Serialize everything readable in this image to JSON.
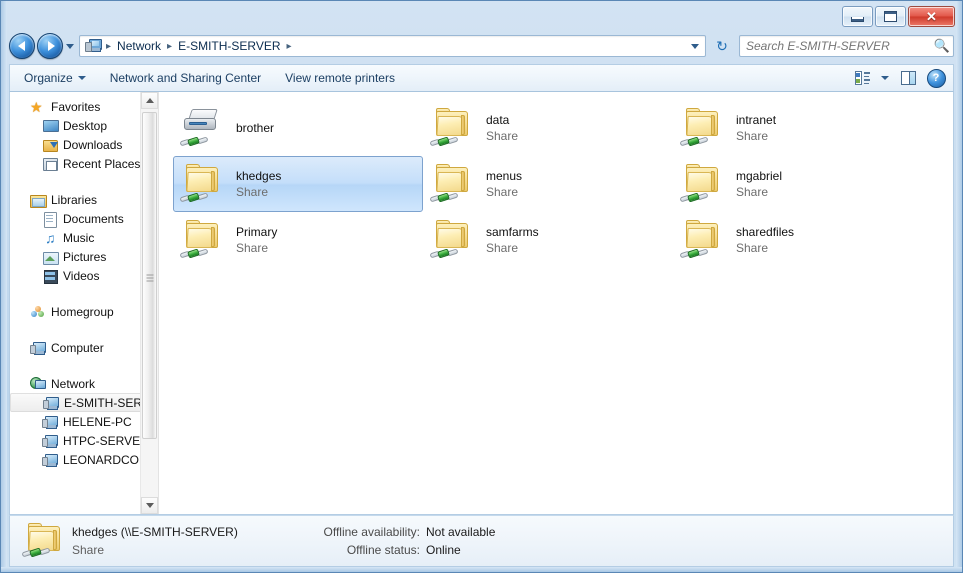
{
  "window": {
    "caption_buttons": [
      {
        "name": "minimize",
        "glyph": "minimize-icon"
      },
      {
        "name": "maximize",
        "glyph": "maximize-icon"
      },
      {
        "name": "close",
        "glyph": "close-icon",
        "label": "✕",
        "color": "#d64b38"
      }
    ]
  },
  "navigation": {
    "back_tooltip": "Back",
    "forward_tooltip": "Forward",
    "recent_pages_tooltip": "Recent pages",
    "refresh_label": "↻",
    "address": {
      "icon": "network-computer-icon",
      "crumbs": [
        "Network",
        "E-SMITH-SERVER"
      ],
      "separator": "▸"
    },
    "search": {
      "placeholder": "Search E-SMITH-SERVER",
      "value": "",
      "icon": "search-icon"
    }
  },
  "toolbar": {
    "organize_label": "Organize",
    "network_sharing_label": "Network and Sharing Center",
    "view_remote_printers_label": "View remote printers",
    "change_view_tooltip": "Change your view",
    "preview_pane_tooltip": "Show the preview pane",
    "help_label": "?",
    "help_tooltip": "Get help"
  },
  "sidebar": {
    "groups": [
      {
        "header": {
          "label": "Favorites",
          "icon": "star-icon"
        },
        "items": [
          {
            "label": "Desktop",
            "icon": "desktop-icon"
          },
          {
            "label": "Downloads",
            "icon": "downloads-icon"
          },
          {
            "label": "Recent Places",
            "icon": "recent-places-icon"
          }
        ]
      },
      {
        "header": {
          "label": "Libraries",
          "icon": "libraries-icon"
        },
        "items": [
          {
            "label": "Documents",
            "icon": "documents-icon"
          },
          {
            "label": "Music",
            "icon": "music-icon"
          },
          {
            "label": "Pictures",
            "icon": "pictures-icon"
          },
          {
            "label": "Videos",
            "icon": "videos-icon"
          }
        ]
      },
      {
        "header": {
          "label": "Homegroup",
          "icon": "homegroup-icon"
        },
        "items": []
      },
      {
        "header": {
          "label": "Computer",
          "icon": "computer-icon"
        },
        "items": []
      },
      {
        "header": {
          "label": "Network",
          "icon": "network-globe-icon"
        },
        "items": [
          {
            "label": "E-SMITH-SERVER",
            "icon": "network-computer-icon",
            "selected": true
          },
          {
            "label": "HELENE-PC",
            "icon": "network-computer-icon"
          },
          {
            "label": "HTPC-SERVER",
            "icon": "network-computer-icon"
          },
          {
            "label": "LEONARDCOHEN",
            "icon": "network-computer-icon"
          }
        ]
      }
    ],
    "scrollbar": {
      "up_arrow": "▲",
      "down_arrow": "▼"
    }
  },
  "files": {
    "items": [
      {
        "name": "brother",
        "sub": "",
        "icon": "network-printer-icon",
        "selected": false
      },
      {
        "name": "data",
        "sub": "Share",
        "icon": "network-share-folder-icon",
        "selected": false
      },
      {
        "name": "intranet",
        "sub": "Share",
        "icon": "network-share-folder-icon",
        "selected": false
      },
      {
        "name": "khedges",
        "sub": "Share",
        "icon": "network-share-folder-icon",
        "selected": true
      },
      {
        "name": "menus",
        "sub": "Share",
        "icon": "network-share-folder-icon",
        "selected": false
      },
      {
        "name": "mgabriel",
        "sub": "Share",
        "icon": "network-share-folder-icon",
        "selected": false
      },
      {
        "name": "Primary",
        "sub": "Share",
        "icon": "network-share-folder-icon",
        "selected": false
      },
      {
        "name": "samfarms",
        "sub": "Share",
        "icon": "network-share-folder-icon",
        "selected": false
      },
      {
        "name": "sharedfiles",
        "sub": "Share",
        "icon": "network-share-folder-icon",
        "selected": false
      }
    ]
  },
  "details": {
    "icon": "network-share-folder-icon",
    "title": "khedges (\\\\E-SMITH-SERVER)",
    "subtitle": "Share",
    "properties": [
      {
        "key": "Offline availability:",
        "value": "Not available"
      },
      {
        "key": "Offline status:",
        "value": "Online"
      }
    ]
  },
  "colors": {
    "selection": "#c4defa",
    "selection_border": "#7da2ce",
    "frame": "#c6dbef",
    "folder_yellow": "#f6dc8e",
    "plug_green": "#35a93a"
  }
}
